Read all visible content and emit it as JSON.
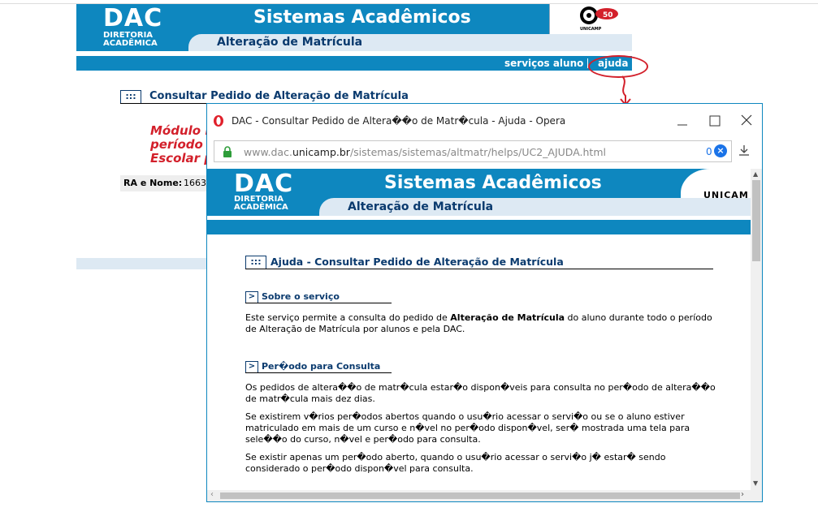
{
  "background_page": {
    "dac": "DAC",
    "diretoria_line1": "DIRETORIA",
    "diretoria_line2": "ACADÊMICA",
    "title": "Sistemas Acadêmicos",
    "subtitle": "Alteração de Matrícula",
    "logo_text": "UNICAMP",
    "nav": {
      "servicos": "serviços aluno",
      "ajuda": "ajuda"
    },
    "section_marker": ":::",
    "section_title": "Consultar Pedido de Alteração de Matrícula",
    "red_line1": "Módulo i",
    "red_line2": "período d",
    "red_line3": "Escolar p",
    "ra_label": "RA e Nome:",
    "ra_value": "1663"
  },
  "popup": {
    "window_title": "DAC - Consultar Pedido de Altera��o de Matr�cula - Ajuda - Opera",
    "url_prefix": "www.dac.",
    "url_domain": "unicamp.br",
    "url_path": "/sistemas/sistemas/altmatr/helps/UC2_AJUDA.html",
    "url_badge": "0",
    "url_clear": "×",
    "colors": {
      "brand_blue": "#0e87bf",
      "light_band": "#dde9f3",
      "annotation_red": "#d3202b"
    },
    "page": {
      "dac": "DAC",
      "diretoria_line1": "DIRETORIA",
      "diretoria_line2": "ACADÊMICA",
      "title": "Sistemas Acadêmicos",
      "subtitle": "Alteração de Matrícula",
      "logo_text": "UNICAM",
      "help_marker": ":::",
      "help_title": "Ajuda - Consultar Pedido de Alteração de Matrícula",
      "section1_marker": ">",
      "section1_title": "Sobre o serviço",
      "section1_text_a": "Este serviço permite a consulta do pedido de ",
      "section1_text_bold": "Alteração de Matrícula",
      "section1_text_b": " do aluno durante todo o período de Alteração de Matrícula por alunos e pela DAC.",
      "section2_marker": ">",
      "section2_title": "Per�odo para Consulta",
      "p1": "Os pedidos de altera��o de matr�cula estar�o dispon�veis para consulta no per�odo de altera��o de matr�cula mais dez dias.",
      "p2": "Se existirem v�rios per�odos abertos quando o usu�rio acessar o servi�o ou se o aluno estiver matriculado em mais de um curso e n�vel no per�odo dispon�vel, ser� mostrada uma tela para sele��o do curso, n�vel e per�odo para consulta.",
      "p3": "Se existir apenas um per�odo aberto, quando o usu�rio acessar o servi�o j� estar� sendo considerado o per�odo dispon�vel para consulta."
    }
  }
}
